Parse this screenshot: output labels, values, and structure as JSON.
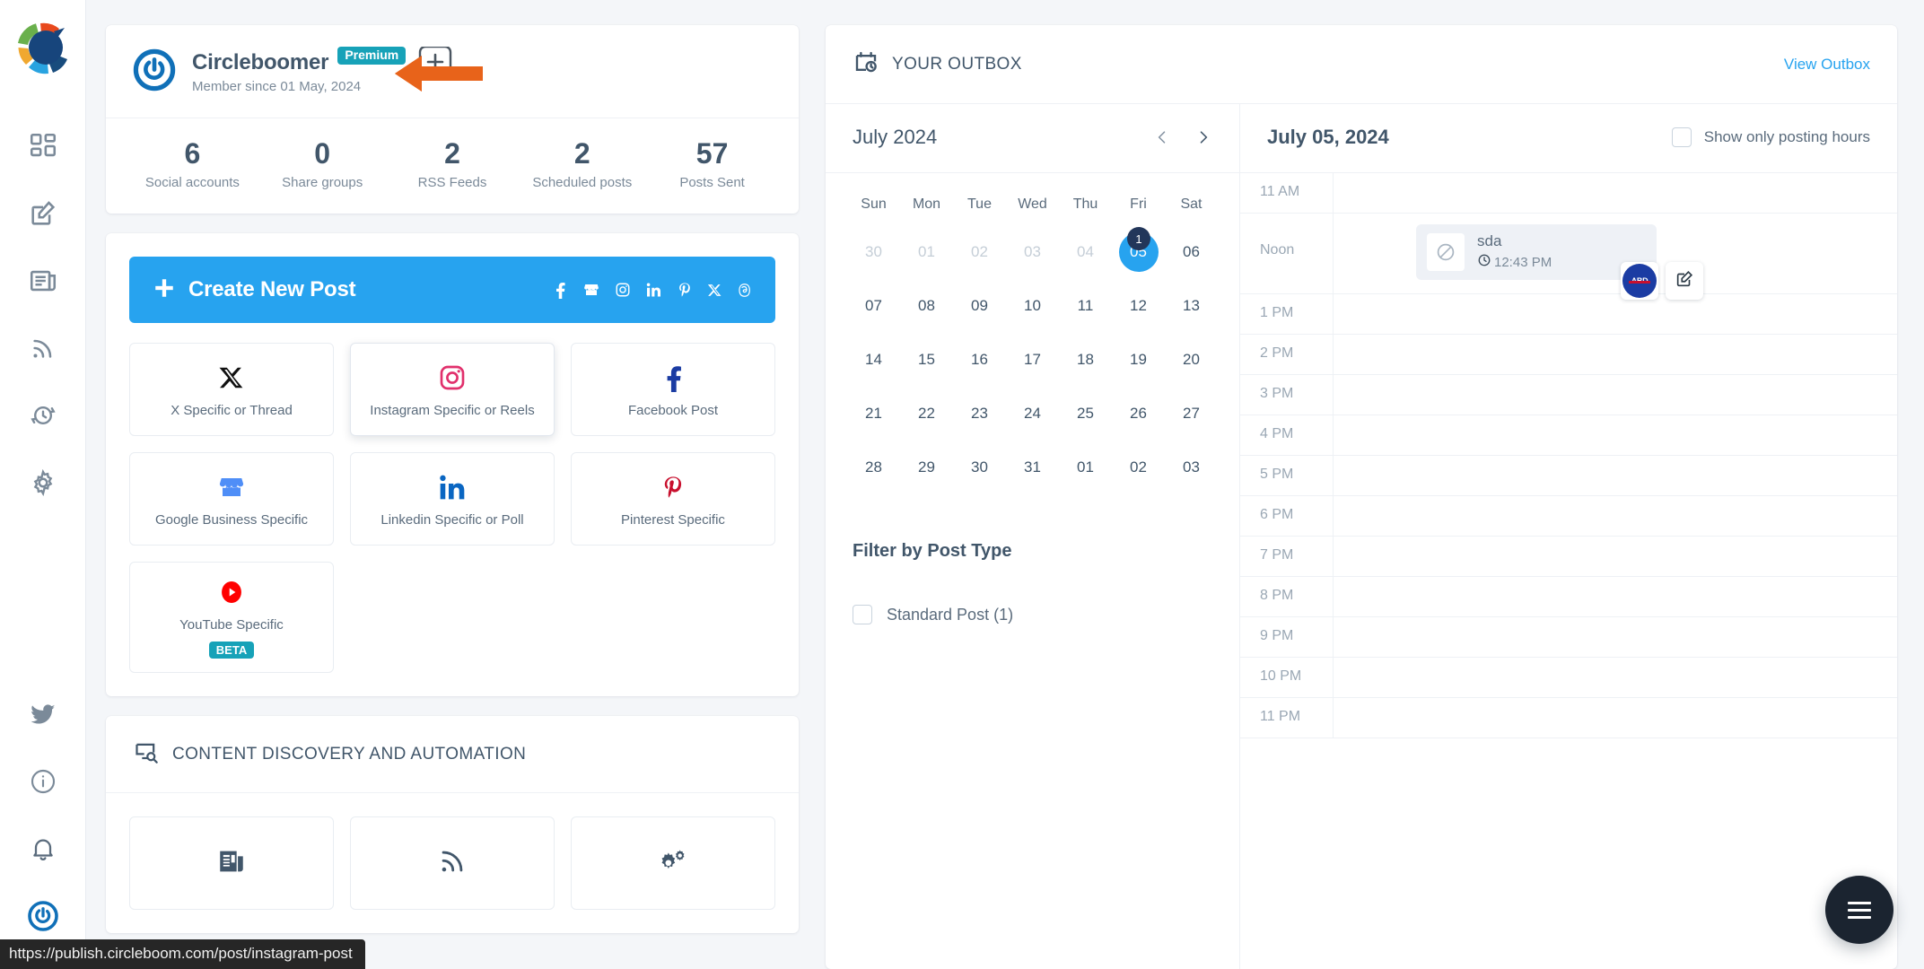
{
  "sidebar": {
    "logo": "circleboom-logo",
    "items": [
      {
        "name": "dashboard",
        "icon": "grid-icon"
      },
      {
        "name": "compose",
        "icon": "pencil-square-icon"
      },
      {
        "name": "news",
        "icon": "newspaper-icon"
      },
      {
        "name": "rss",
        "icon": "rss-icon"
      },
      {
        "name": "history",
        "icon": "clock-refresh-icon"
      },
      {
        "name": "settings",
        "icon": "gear-icon"
      }
    ],
    "bottom_items": [
      {
        "name": "twitter",
        "icon": "twitter-bird-icon"
      },
      {
        "name": "info",
        "icon": "info-circle-icon"
      },
      {
        "name": "notifications",
        "icon": "bell-icon"
      },
      {
        "name": "account",
        "icon": "user-avatar-icon"
      }
    ]
  },
  "profile": {
    "name": "Circleboomer",
    "plan_badge": "Premium",
    "member_since": "Member since 01 May, 2024",
    "stats": [
      {
        "value": "6",
        "label": "Social accounts"
      },
      {
        "value": "0",
        "label": "Share groups"
      },
      {
        "value": "2",
        "label": "RSS Feeds"
      },
      {
        "value": "2",
        "label": "Scheduled posts"
      },
      {
        "value": "57",
        "label": "Posts Sent"
      }
    ]
  },
  "create": {
    "banner_label": "Create New Post",
    "plus_icon": "plus-icon",
    "network_icons": [
      {
        "name": "facebook-icon",
        "glyph": "f"
      },
      {
        "name": "google-business-icon",
        "glyph": "🏪"
      },
      {
        "name": "instagram-icon",
        "glyph": "▢"
      },
      {
        "name": "linkedin-icon",
        "glyph": "in"
      },
      {
        "name": "pinterest-icon",
        "glyph": "P"
      },
      {
        "name": "x-icon",
        "glyph": "X"
      },
      {
        "name": "threads-icon",
        "glyph": "@"
      }
    ],
    "types": [
      {
        "label": "X Specific or Thread",
        "icon": "x-icon",
        "hovered": false
      },
      {
        "label": "Instagram Specific or Reels",
        "icon": "instagram-icon",
        "hovered": true
      },
      {
        "label": "Facebook Post",
        "icon": "facebook-icon",
        "hovered": false
      },
      {
        "label": "Google Business Specific",
        "icon": "google-business-icon",
        "hovered": false
      },
      {
        "label": "Linkedin Specific or Poll",
        "icon": "linkedin-icon",
        "hovered": false
      },
      {
        "label": "Pinterest Specific",
        "icon": "pinterest-icon",
        "hovered": false
      }
    ],
    "youtube": {
      "label": "YouTube Specific",
      "badge": "BETA",
      "icon": "youtube-icon"
    }
  },
  "content_discovery": {
    "title": "CONTENT DISCOVERY AND AUTOMATION",
    "icon": "screen-search-icon",
    "cards": [
      {
        "name": "articles",
        "icon": "newspaper-icon"
      },
      {
        "name": "rss-feeds",
        "icon": "rss-icon"
      },
      {
        "name": "automation",
        "icon": "gears-icon"
      }
    ]
  },
  "outbox": {
    "title": "YOUR OUTBOX",
    "icon": "calendar-clock-icon",
    "view_link": "View Outbox",
    "calendar": {
      "month_label": "July 2024",
      "prev_icon": "chevron-left-icon",
      "next_icon": "chevron-right-icon",
      "day_names": [
        "Sun",
        "Mon",
        "Tue",
        "Wed",
        "Thu",
        "Fri",
        "Sat"
      ],
      "weeks": [
        [
          {
            "d": "30",
            "muted": true
          },
          {
            "d": "01",
            "muted": true
          },
          {
            "d": "02",
            "muted": true
          },
          {
            "d": "03",
            "muted": true
          },
          {
            "d": "04",
            "muted": true
          },
          {
            "d": "05",
            "muted": false,
            "selected": true,
            "count": "1"
          },
          {
            "d": "06",
            "muted": false
          }
        ],
        [
          {
            "d": "07"
          },
          {
            "d": "08"
          },
          {
            "d": "09"
          },
          {
            "d": "10"
          },
          {
            "d": "11"
          },
          {
            "d": "12"
          },
          {
            "d": "13"
          }
        ],
        [
          {
            "d": "14"
          },
          {
            "d": "15"
          },
          {
            "d": "16"
          },
          {
            "d": "17"
          },
          {
            "d": "18"
          },
          {
            "d": "19"
          },
          {
            "d": "20"
          }
        ],
        [
          {
            "d": "21"
          },
          {
            "d": "22"
          },
          {
            "d": "23"
          },
          {
            "d": "24"
          },
          {
            "d": "25"
          },
          {
            "d": "26"
          },
          {
            "d": "27"
          }
        ],
        [
          {
            "d": "28"
          },
          {
            "d": "29"
          },
          {
            "d": "30"
          },
          {
            "d": "31"
          },
          {
            "d": "01",
            "muted": false
          },
          {
            "d": "02",
            "muted": false
          },
          {
            "d": "03",
            "muted": false
          }
        ]
      ]
    },
    "filter": {
      "title": "Filter by Post Type",
      "options": [
        {
          "label": "Standard Post (1)",
          "checked": false
        }
      ]
    },
    "day": {
      "date_label": "July 05, 2024",
      "toggle_label": "Show only posting hours",
      "toggle_checked": false,
      "slots": [
        {
          "label": "11 AM",
          "tall": false
        },
        {
          "label": "Noon",
          "tall": true
        },
        {
          "label": "1 PM",
          "tall": false
        },
        {
          "label": "2 PM",
          "tall": false
        },
        {
          "label": "3 PM",
          "tall": false
        },
        {
          "label": "4 PM",
          "tall": false
        },
        {
          "label": "5 PM",
          "tall": false
        },
        {
          "label": "6 PM",
          "tall": false
        },
        {
          "label": "7 PM",
          "tall": false
        },
        {
          "label": "8 PM",
          "tall": false
        },
        {
          "label": "9 PM",
          "tall": false
        },
        {
          "label": "10 PM",
          "tall": false
        },
        {
          "label": "11 PM",
          "tall": false
        }
      ],
      "event": {
        "name": "sda",
        "time": "12:43 PM",
        "clock_icon": "clock-icon",
        "thumb_icon": "no-image-icon",
        "avatar_text": "ABD",
        "edit_icon": "edit-icon"
      }
    }
  },
  "fab": {
    "icon": "menu-icon"
  },
  "status_bar": {
    "url": "https://publish.circleboom.com/post/instagram-post"
  },
  "colors": {
    "accent_blue": "#27a3ef",
    "teal_badge": "#17a2b8",
    "text_dark": "#41566a",
    "text_muted": "#7b8a99",
    "arrow_orange": "#e8631a",
    "page_bg": "#f4f6f9"
  }
}
